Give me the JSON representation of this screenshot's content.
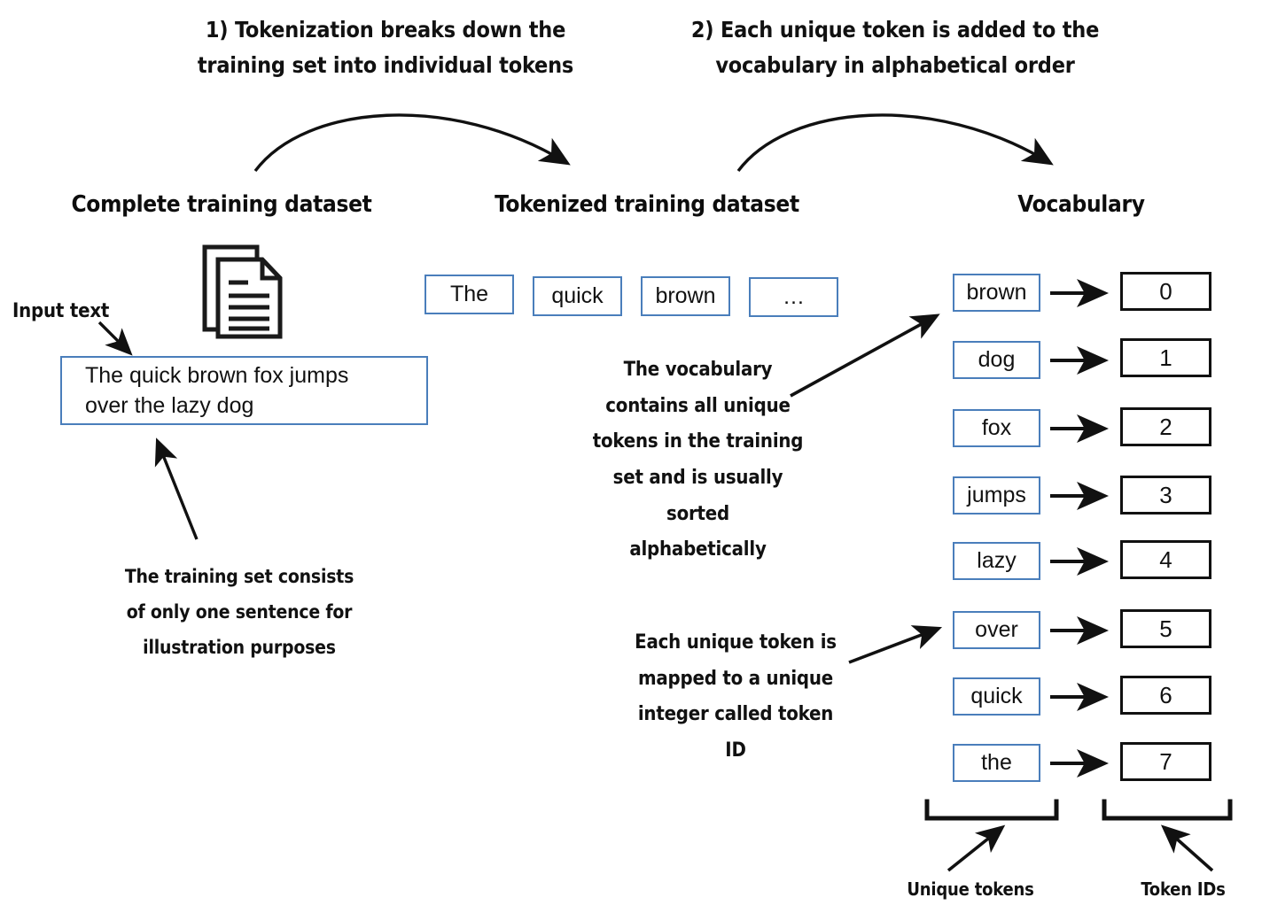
{
  "steps": [
    {
      "id": "step-1",
      "text": "1) Tokenization breaks down the\ntraining set into individual tokens"
    },
    {
      "id": "step-2",
      "text": "2) Each unique token is added to the\nvocabulary in alphabetical order"
    }
  ],
  "headings": {
    "dataset": "Complete training dataset",
    "tokenized": "Tokenized training dataset",
    "vocabulary": "Vocabulary"
  },
  "dataset": {
    "input_label": "Input text",
    "input_text": "The quick brown fox jumps\nover the lazy dog",
    "note": "The training set consists\nof only one sentence for\nillustration purposes",
    "icon": "document-stack-icon"
  },
  "tokenized": {
    "tokens": [
      "The",
      "quick",
      "brown",
      "…"
    ],
    "note": "The vocabulary\ncontains all unique\ntokens in the training\nset and is usually\nsorted\nalphabetically"
  },
  "vocabulary": {
    "note": "Each unique token is\nmapped to a unique\ninteger called token\nID",
    "entries": [
      {
        "token": "brown",
        "id": "0"
      },
      {
        "token": "dog",
        "id": "1"
      },
      {
        "token": "fox",
        "id": "2"
      },
      {
        "token": "jumps",
        "id": "3"
      },
      {
        "token": "lazy",
        "id": "4"
      },
      {
        "token": "over",
        "id": "5"
      },
      {
        "token": "quick",
        "id": "6"
      },
      {
        "token": "the",
        "id": "7"
      }
    ],
    "bracket_labels": {
      "tokens": "Unique tokens",
      "ids": "Token IDs"
    }
  },
  "colors": {
    "box_blue": "#4a7ebb",
    "box_black": "#111111",
    "text": "#111111",
    "background": "#ffffff"
  }
}
